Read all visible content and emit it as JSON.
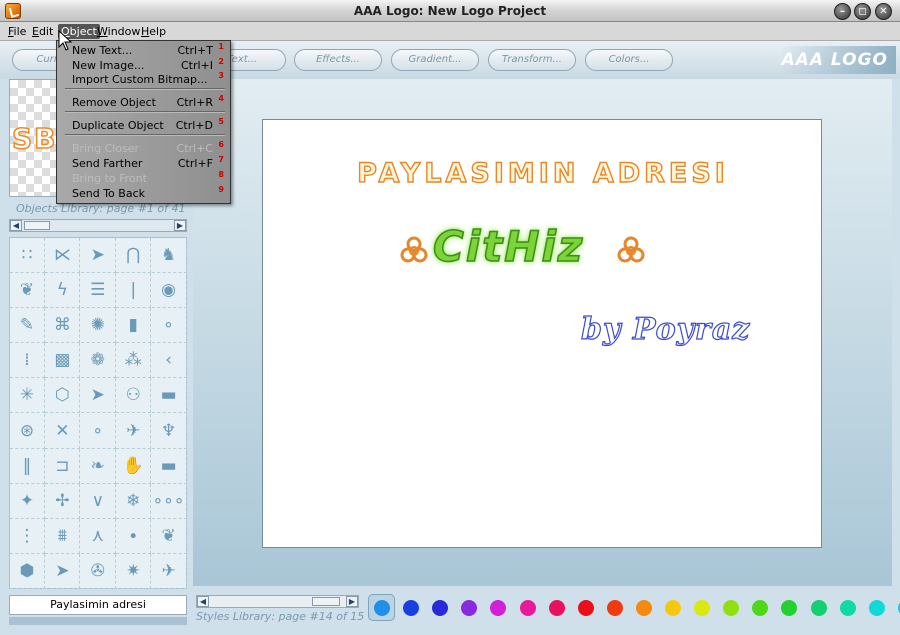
{
  "window": {
    "title": "AAA Logo: New Logo Project",
    "buttons": {
      "minimize": "–",
      "maximize": "◻",
      "close": "✕"
    }
  },
  "menubar": {
    "items": [
      {
        "pre": "",
        "ul": "F",
        "post": "ile"
      },
      {
        "pre": "",
        "ul": "E",
        "post": "dit"
      },
      {
        "pre": "",
        "ul": "O",
        "post": "bject"
      },
      {
        "pre": "",
        "ul": "W",
        "post": "indow"
      },
      {
        "pre": "",
        "ul": "H",
        "post": "elp"
      }
    ]
  },
  "toolbar": {
    "buttons": [
      "Curre...",
      "Text...",
      "Effects...",
      "Gradient...",
      "Transform...",
      "Colors..."
    ],
    "brand": "AAA LOGO"
  },
  "object_menu": {
    "items": [
      {
        "label": "New Text...",
        "shortcut": "Ctrl+T",
        "num": "1",
        "enabled": true
      },
      {
        "label": "New Image...",
        "shortcut": "Ctrl+I",
        "num": "2",
        "enabled": true
      },
      {
        "label": "Import Custom Bitmap...",
        "shortcut": "",
        "num": "3",
        "enabled": true
      },
      {
        "label": "Remove Object",
        "shortcut": "Ctrl+R",
        "num": "4",
        "enabled": true
      },
      {
        "label": "Duplicate Object",
        "shortcut": "Ctrl+D",
        "num": "5",
        "enabled": true
      },
      {
        "label": "Bring Closer",
        "shortcut": "Ctrl+C",
        "num": "6",
        "enabled": false
      },
      {
        "label": "Send Farther",
        "shortcut": "Ctrl+F",
        "num": "7",
        "enabled": true
      },
      {
        "label": "Bring to Front",
        "shortcut": "",
        "num": "8",
        "enabled": false
      },
      {
        "label": "Send To Back",
        "shortcut": "",
        "num": "9",
        "enabled": true
      }
    ]
  },
  "left_panel": {
    "preview_text": "SB",
    "library_label": "Objects Library: page #1 of 41",
    "scroll": {
      "left": "◀",
      "right": "▶"
    },
    "object_glyphs": [
      "∷",
      "⋉",
      "➤",
      "⋂",
      "♞",
      "❦",
      "ϟ",
      "☰",
      "❘",
      "◉",
      "✎",
      "⌘",
      "✺",
      "▮",
      "∘",
      "⁞",
      "▩",
      "❁",
      "⁂",
      "‹",
      "✳",
      "⬡",
      "➤",
      "⚇",
      "▬",
      "⊛",
      "✕",
      "∘",
      "✈",
      "♆",
      "‖",
      "⊐",
      "❧",
      "✋",
      "▬",
      "✦",
      "✢",
      "∨",
      "❄",
      "∘∘∘",
      "⋮",
      "⩩",
      "⋏",
      "∙",
      "❦",
      "⬢",
      "➤",
      "✇",
      "✷",
      "✈"
    ],
    "text_field": "Paylasimin adresi"
  },
  "canvas": {
    "line1": "PAYLASIMIN ADRESI",
    "line2": "CitHiz",
    "line3": "by Poyraz",
    "colors": {
      "line1_fill": "#fff6d8",
      "line1_stroke": "#e8862a",
      "line2": "#7dd33a",
      "line3_stroke": "#3a4ad0"
    }
  },
  "bottom": {
    "styles_label": "Styles Library: page #14 of 15",
    "scroll": {
      "left": "◀",
      "right": "▶"
    },
    "swatches": [
      "#1f8fe8",
      "#1a3fe0",
      "#2a2ad8",
      "#8a2ae0",
      "#d020d8",
      "#e81a9a",
      "#e81060",
      "#e8101a",
      "#f03a10",
      "#f58a10",
      "#f5c810",
      "#d8e810",
      "#90e010",
      "#50d818",
      "#22d030",
      "#12d070",
      "#10d8a8",
      "#10d8d8",
      "#12c8f0"
    ],
    "selected_swatch": 0
  }
}
